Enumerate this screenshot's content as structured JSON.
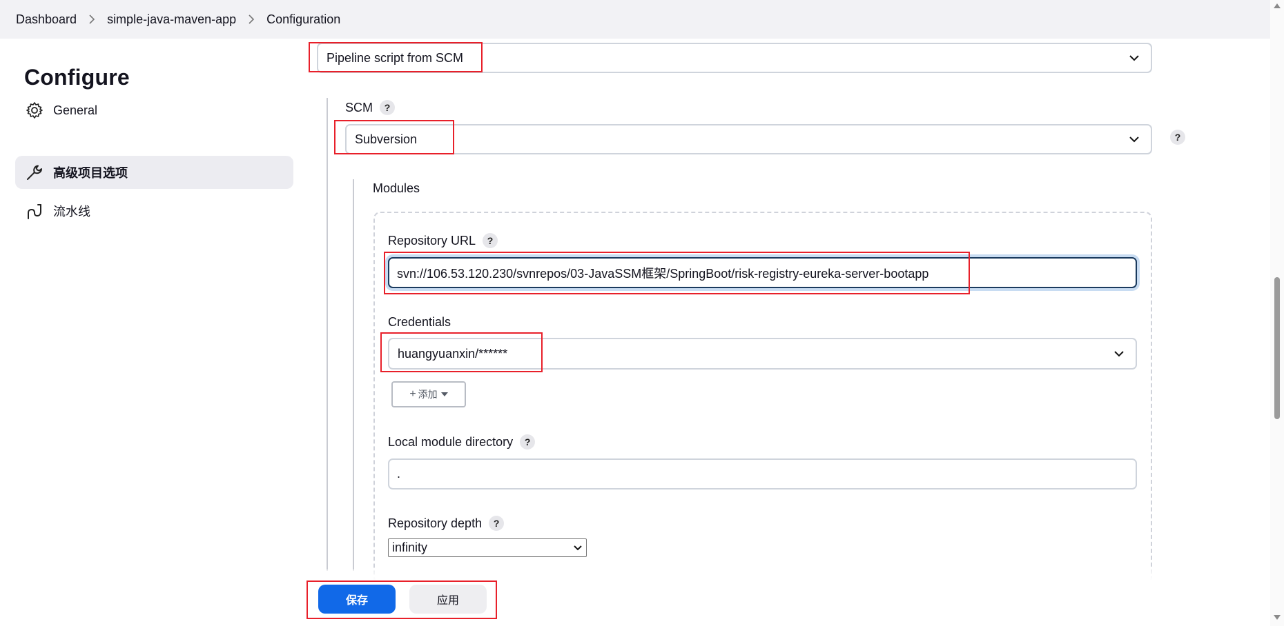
{
  "breadcrumb": [
    "Dashboard",
    "simple-java-maven-app",
    "Configuration"
  ],
  "sidebar": {
    "title": "Configure",
    "items": [
      {
        "label": "General",
        "icon": "gear-icon"
      },
      {
        "label": "高级项目选项",
        "icon": "wrench-icon"
      },
      {
        "label": "流水线",
        "icon": "pipeline-icon"
      }
    ]
  },
  "pipeline": {
    "definition_value": "Pipeline script from SCM"
  },
  "scm": {
    "label": "SCM",
    "value": "Subversion",
    "help": "?"
  },
  "modules": {
    "label": "Modules",
    "repository_url_label": "Repository URL",
    "repository_url_value": "svn://106.53.120.230/svnrepos/03-JavaSSM框架/SpringBoot/risk-registry-eureka-server-bootapp",
    "credentials_label": "Credentials",
    "credentials_value": "huangyuanxin/******",
    "add_button_label": "添加",
    "local_dir_label": "Local module directory",
    "local_dir_value": ".",
    "depth_label": "Repository depth",
    "depth_value": "infinity"
  },
  "actions": {
    "save_label": "保存",
    "apply_label": "应用"
  },
  "colors": {
    "primary": "#1169e8",
    "highlight": "#e8202a",
    "active_item_bg": "#ececf1"
  }
}
